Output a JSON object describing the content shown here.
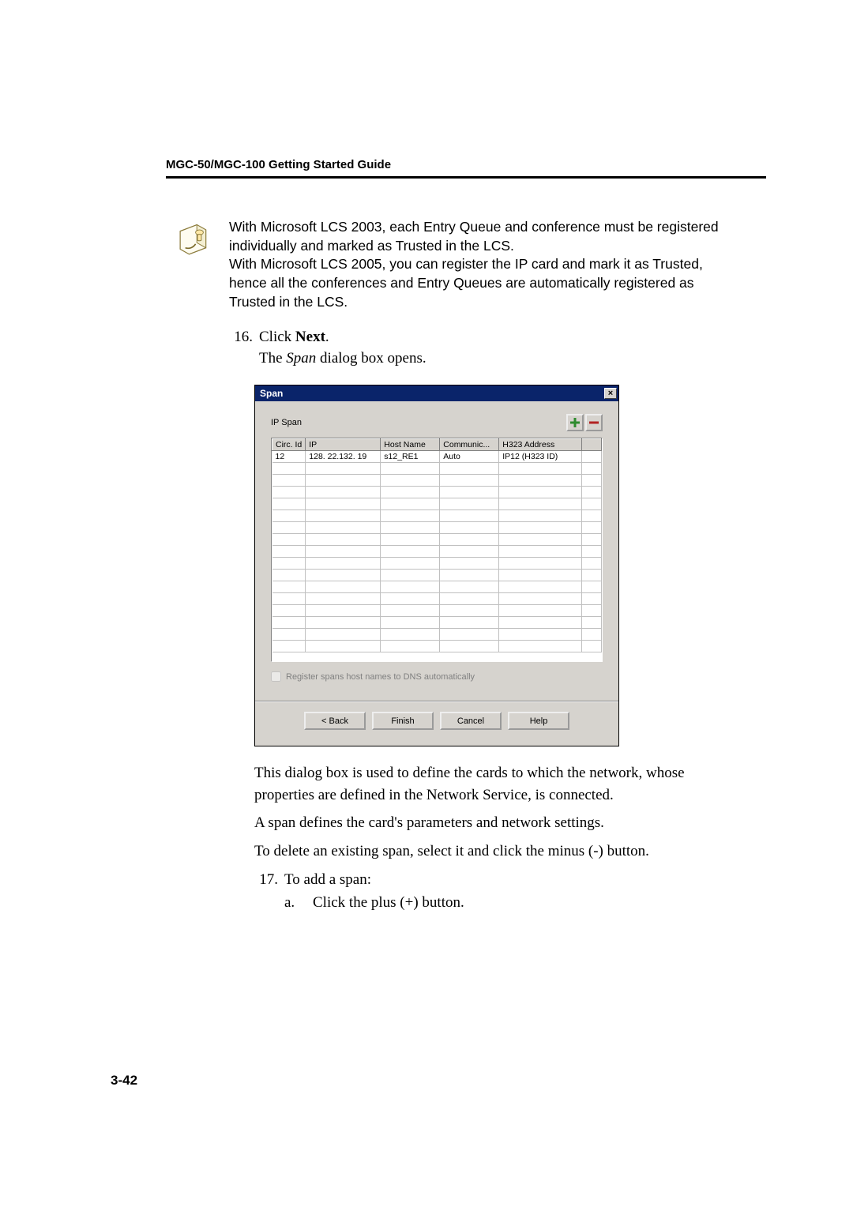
{
  "header": {
    "title": "MGC-50/MGC-100 Getting Started Guide"
  },
  "note": {
    "text": "With Microsoft LCS 2003, each Entry Queue and conference must be registered individually and marked as Trusted in the LCS.\nWith Microsoft LCS 2005, you can register the IP card and mark it as Trusted, hence all the conferences and Entry Queues are automatically registered as Trusted in the LCS."
  },
  "steps": {
    "s16_num": "16.",
    "s16_click": "Click ",
    "s16_next": "Next",
    "s16_period": ".",
    "s16_result_a": "The ",
    "s16_result_b": "Span",
    "s16_result_c": " dialog box opens."
  },
  "dialog": {
    "title": "Span",
    "close_glyph": "×",
    "tab_label": "IP Span",
    "columns": {
      "circ": "Circ. Id",
      "ip": "IP",
      "host": "Host Name",
      "comm": "Communic...",
      "h323": "H323 Address"
    },
    "row": {
      "circ": "12",
      "ip": "128. 22.132. 19",
      "host": "s12_RE1",
      "comm": "Auto",
      "h323": "IP12 (H323 ID)"
    },
    "checkbox_label": "Register spans host names to DNS automatically",
    "buttons": {
      "back": "< Back",
      "finish": "Finish",
      "cancel": "Cancel",
      "help": "Help"
    }
  },
  "after": {
    "p1": "This dialog box is used to define the cards to which the network, whose properties are defined in the Network Service, is connected.",
    "p2": "A span defines the card's parameters and network settings.",
    "p3": "To delete an existing span, select it and click the minus (-) button."
  },
  "s17": {
    "num": "17.",
    "text": "To add a span:",
    "a_letter": "a.",
    "a_text": "Click the plus (+) button."
  },
  "page_number": "3-42"
}
